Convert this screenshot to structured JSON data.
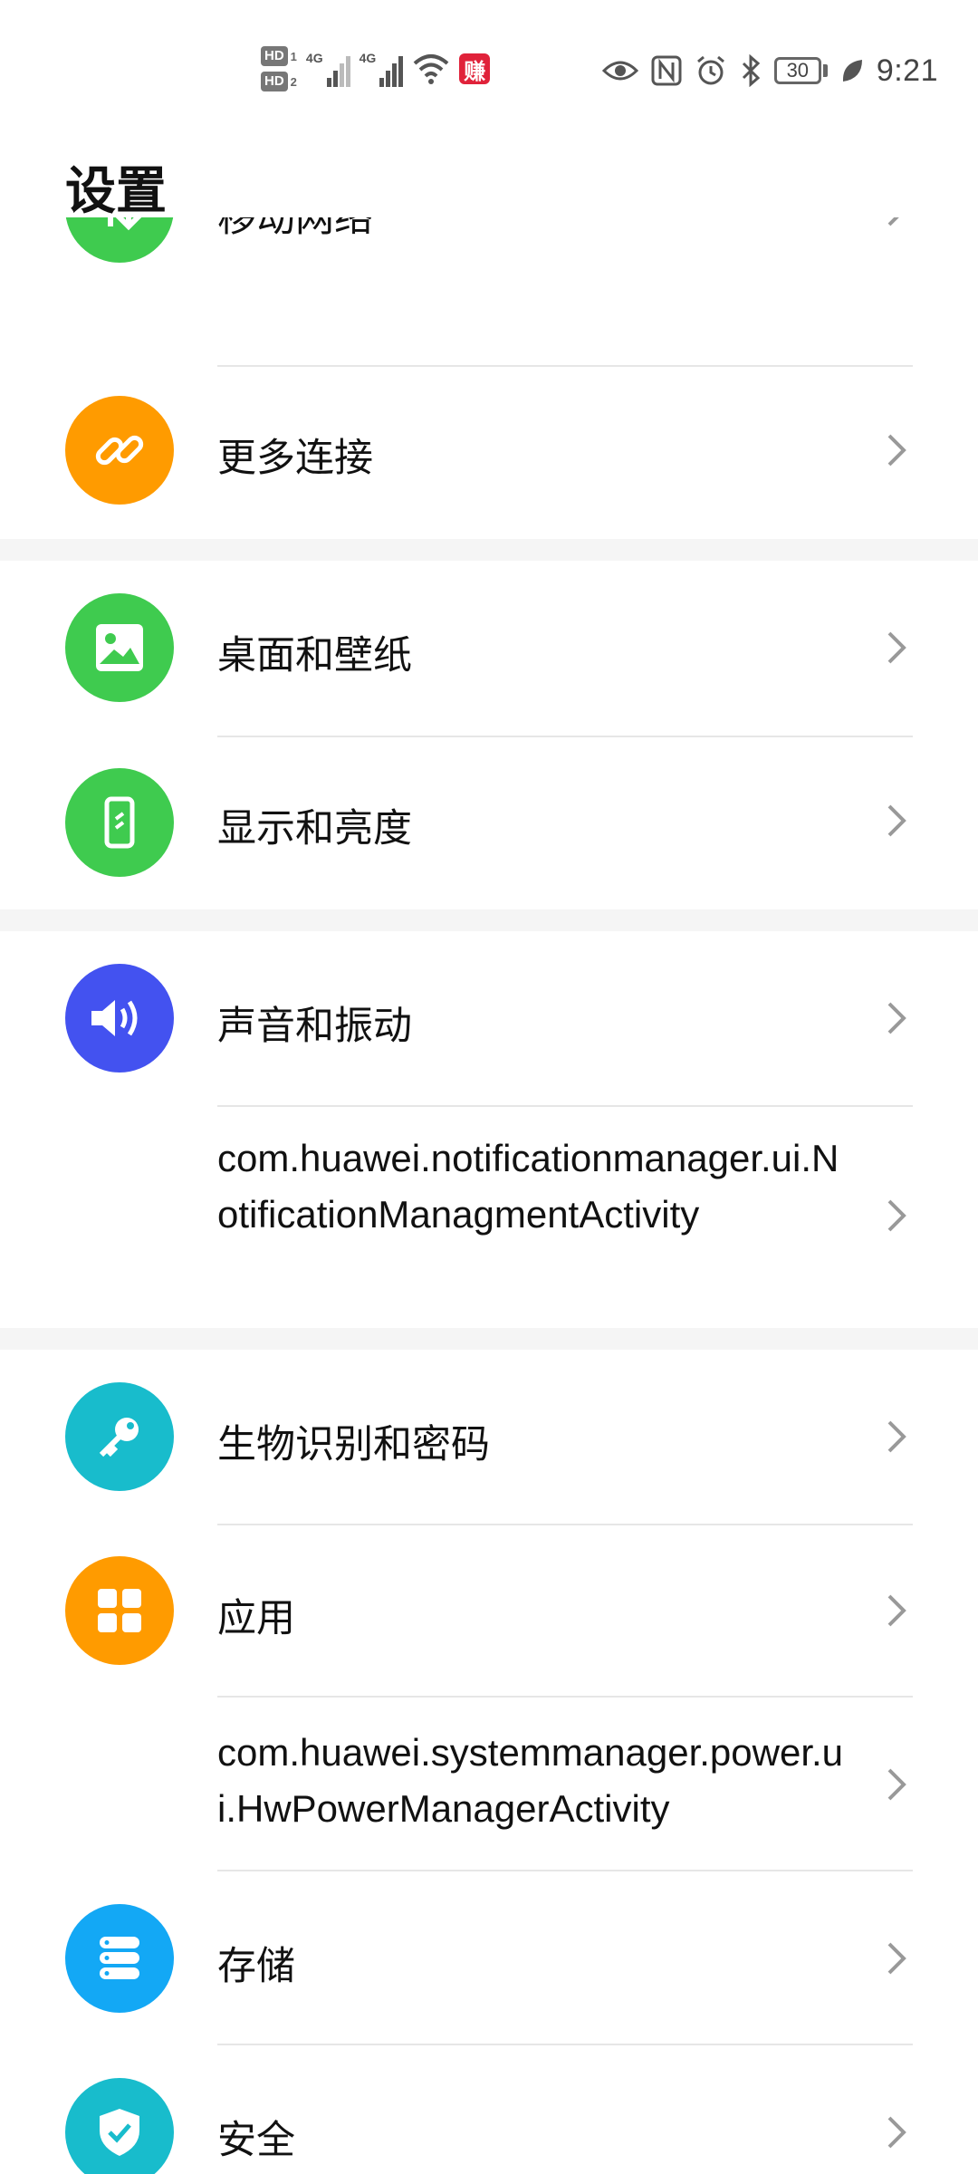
{
  "status_bar": {
    "hd1": "HD",
    "hd2": "HD",
    "hd1_sub": "1",
    "hd2_sub": "2",
    "sig1_label": "4G",
    "sig2_label": "4G",
    "promo_badge": "赚",
    "battery": "30",
    "time": "9:21"
  },
  "header": {
    "title": "设置"
  },
  "items": [
    {
      "label": "移动网络",
      "icon": "mobile-network-icon",
      "color": "#3fcb4f"
    },
    {
      "label": "更多连接",
      "icon": "link-icon",
      "color": "#ff9b00"
    },
    {
      "label": "桌面和壁纸",
      "icon": "image-icon",
      "color": "#3fcb4f"
    },
    {
      "label": "显示和亮度",
      "icon": "phone-brightness-icon",
      "color": "#3fcb4f"
    },
    {
      "label": "声音和振动",
      "icon": "speaker-icon",
      "color": "#4352f0"
    },
    {
      "label": "com.huawei.notificationmanager.ui.NotificationManagmentActivity"
    },
    {
      "label": "生物识别和密码",
      "icon": "key-icon",
      "color": "#18bccc"
    },
    {
      "label": "应用",
      "icon": "apps-grid-icon",
      "color": "#ff9b00"
    },
    {
      "label": "com.huawei.systemmanager.power.ui.HwPowerManagerActivity"
    },
    {
      "label": "存储",
      "icon": "storage-icon",
      "color": "#13a8f5"
    },
    {
      "label": "安全",
      "icon": "shield-icon",
      "color": "#18bccc"
    }
  ]
}
